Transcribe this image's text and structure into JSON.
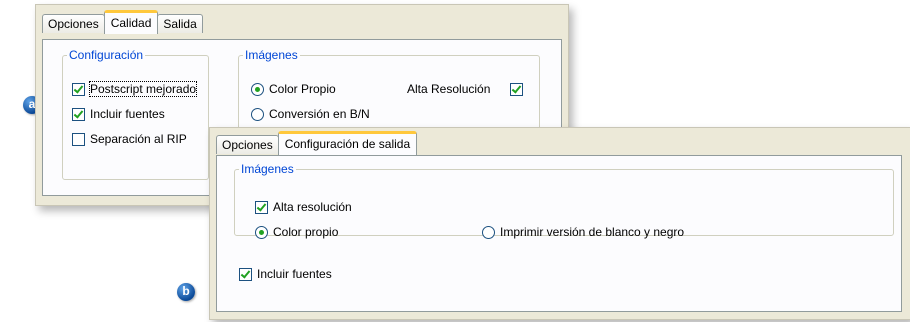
{
  "dialog_a": {
    "tabs": [
      {
        "label": "Opciones"
      },
      {
        "label": "Calidad"
      },
      {
        "label": "Salida"
      }
    ],
    "configuracion": {
      "legend": "Configuración",
      "options": [
        {
          "label": "Postscript mejorado",
          "checked": true
        },
        {
          "label": "Incluir fuentes",
          "checked": true
        },
        {
          "label": "Separación al RIP",
          "checked": false
        }
      ]
    },
    "imagenes": {
      "legend": "Imágenes",
      "color_propio": "Color Propio",
      "conversion": "Conversión en B/N",
      "alta_resolucion": "Alta Resolución"
    }
  },
  "dialog_b": {
    "tabs": [
      {
        "label": "Opciones"
      },
      {
        "label": "Configuración de salida"
      }
    ],
    "imagenes": {
      "legend": "Imágenes",
      "alta_resolucion": "Alta resolución",
      "color_propio": "Color propio",
      "blanco_negro": "Imprimir versión de blanco y negro"
    },
    "incluir_fuentes": "Incluir fuentes"
  },
  "badges": {
    "a": "a",
    "b": "b"
  },
  "colors": {
    "accent_tab": "#ffc83c",
    "legend": "#0046d5",
    "check": "#21a121",
    "dialog_bg": "#ece9d8"
  }
}
